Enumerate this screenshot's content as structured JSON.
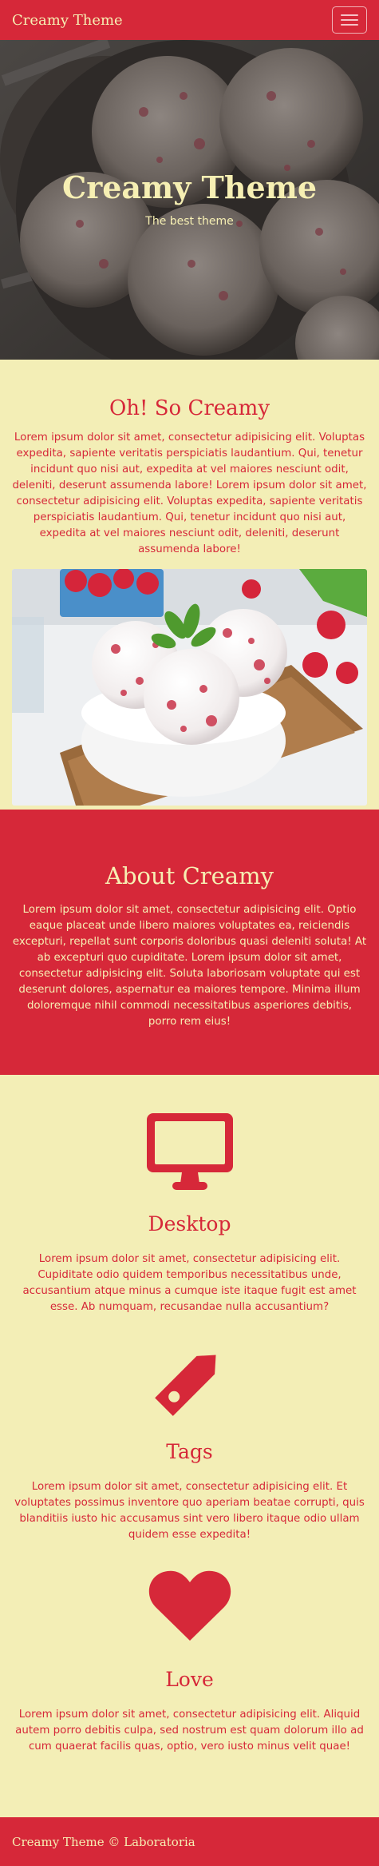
{
  "navbar": {
    "brand": "Creamy Theme",
    "toggle_icon": "hamburger-menu-icon"
  },
  "hero": {
    "title": "Creamy Theme",
    "subtitle": "The best theme"
  },
  "creamy": {
    "heading": "Oh! So Creamy",
    "text": "Lorem ipsum dolor sit amet, consectetur adipisicing elit. Voluptas expedita, sapiente veritatis perspiciatis laudantium. Qui, tenetur incidunt quo nisi aut, expedita at vel maiores nesciunt odit, deleniti, deserunt assumenda labore! Lorem ipsum dolor sit amet, consectetur adipisicing elit. Voluptas expedita, sapiente veritatis perspiciatis laudantium. Qui, tenetur incidunt quo nisi aut, expedita at vel maiores nesciunt odit, deleniti, deserunt assumenda labore!"
  },
  "about": {
    "heading": "About Creamy",
    "text": "Lorem ipsum dolor sit amet, consectetur adipisicing elit. Optio eaque placeat unde libero maiores voluptates ea, reiciendis excepturi, repellat sunt corporis doloribus quasi deleniti soluta! At ab excepturi quo cupiditate. Lorem ipsum dolor sit amet, consectetur adipisicing elit. Soluta laboriosam voluptate qui est deserunt dolores, aspernatur ea maiores tempore. Minima illum doloremque nihil commodi necessitatibus asperiores debitis, porro rem eius!"
  },
  "features": [
    {
      "icon": "desktop-icon",
      "title": "Desktop",
      "text": "Lorem ipsum dolor sit amet, consectetur adipisicing elit. Cupiditate odio quidem temporibus necessitatibus unde, accusantium atque minus a cumque iste itaque fugit est amet esse. Ab numquam, recusandae nulla accusantium?"
    },
    {
      "icon": "tag-icon",
      "title": "Tags",
      "text": "Lorem ipsum dolor sit amet, consectetur adipisicing elit. Et voluptates possimus inventore quo aperiam beatae corrupti, quis blanditiis iusto hic accusamus sint vero libero itaque odio ullam quidem esse expedita!"
    },
    {
      "icon": "heart-icon",
      "title": "Love",
      "text": "Lorem ipsum dolor sit amet, consectetur adipisicing elit. Aliquid autem porro debitis culpa, sed nostrum est quam dolorum illo ad cum quaerat facilis quas, optio, vero iusto minus velit quae!"
    }
  ],
  "footer": {
    "text": "Creamy Theme © Laboratoria"
  },
  "colors": {
    "primary": "#d62839",
    "cream": "#f3eeb6",
    "cream_text": "#f6efb3"
  }
}
